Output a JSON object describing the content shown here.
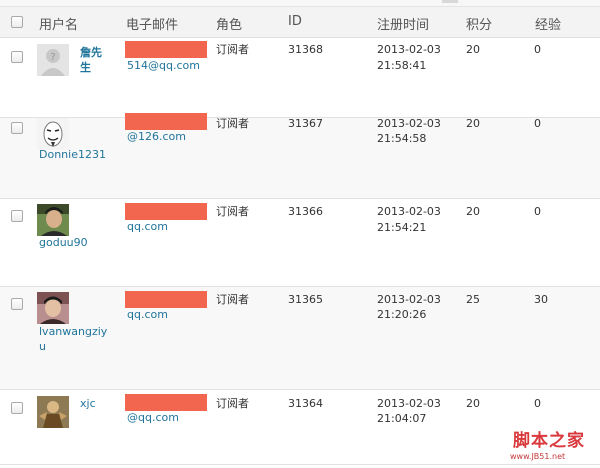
{
  "header": {
    "username": "用户名",
    "email": "电子邮件",
    "role": "角色",
    "id": "ID",
    "registered": "注册时间",
    "points": "积分",
    "experience": "经验"
  },
  "rows": [
    {
      "username": "詹先生",
      "avatar": "default-avatar",
      "email": "514@qq.com",
      "role": "订阅者",
      "id": "31368",
      "date": "2013-02-03",
      "time": "21:58:41",
      "points": "20",
      "exp": "0"
    },
    {
      "username": "Donnie1231",
      "avatar": "mask-avatar",
      "email": "@126.com",
      "role": "订阅者",
      "id": "31367",
      "date": "2013-02-03",
      "time": "21:54:58",
      "points": "20",
      "exp": "0"
    },
    {
      "username": "goduu90",
      "avatar": "photo-avatar",
      "email": "qq.com",
      "role": "订阅者",
      "id": "31366",
      "date": "2013-02-03",
      "time": "21:54:21",
      "points": "20",
      "exp": "0"
    },
    {
      "username": "lvanwangziyu",
      "avatar": "photo-avatar",
      "email": "qq.com",
      "role": "订阅者",
      "id": "31365",
      "date": "2013-02-03",
      "time": "21:20:26",
      "points": "25",
      "exp": "30"
    },
    {
      "username": "xjc",
      "avatar": "figure-avatar",
      "email": "@qq.com",
      "role": "订阅者",
      "id": "31364",
      "date": "2013-02-03",
      "time": "21:04:07",
      "points": "20",
      "exp": "0"
    }
  ],
  "watermark": {
    "main": "脚本之家",
    "sub": "www.JB51.net"
  },
  "colors": {
    "link": "#21759b",
    "redaction": "#f26650",
    "watermark": "#d9393c"
  }
}
